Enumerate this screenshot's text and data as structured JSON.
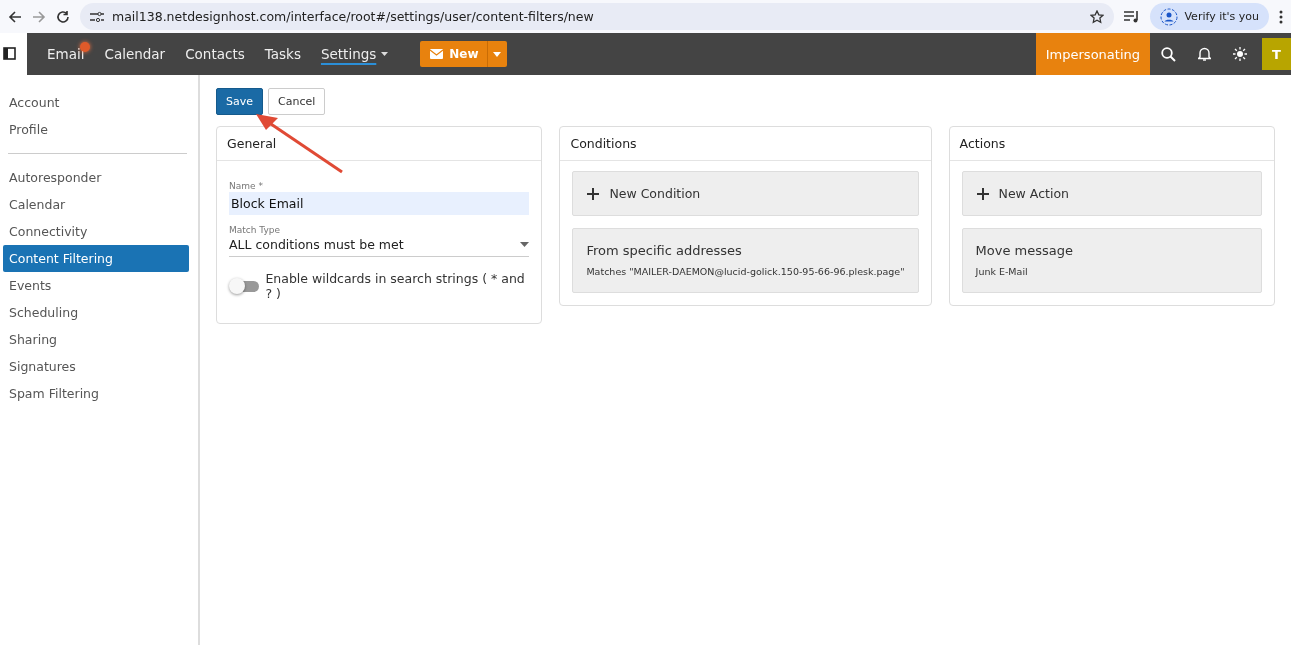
{
  "browser": {
    "url": "mail138.netdesignhost.com/interface/root#/settings/user/content-filters/new",
    "profile_button": "Verify it's you"
  },
  "nav": {
    "tabs": [
      {
        "label": "Email",
        "selected": false,
        "notification": true
      },
      {
        "label": "Calendar",
        "selected": false,
        "notification": false
      },
      {
        "label": "Contacts",
        "selected": false,
        "notification": false
      },
      {
        "label": "Tasks",
        "selected": false,
        "notification": false
      },
      {
        "label": "Settings",
        "selected": true,
        "notification": false
      }
    ],
    "new_button": "New",
    "impersonating": "Impersonating",
    "avatar": "T"
  },
  "sidebar": {
    "groups": [
      [
        {
          "label": "Account",
          "selected": false
        },
        {
          "label": "Profile",
          "selected": false
        }
      ],
      [
        {
          "label": "Autoresponder",
          "selected": false
        },
        {
          "label": "Calendar",
          "selected": false
        },
        {
          "label": "Connectivity",
          "selected": false
        },
        {
          "label": "Content Filtering",
          "selected": true
        },
        {
          "label": "Events",
          "selected": false
        },
        {
          "label": "Scheduling",
          "selected": false
        },
        {
          "label": "Sharing",
          "selected": false
        },
        {
          "label": "Signatures",
          "selected": false
        },
        {
          "label": "Spam Filtering",
          "selected": false
        }
      ]
    ]
  },
  "toolbar": {
    "save": "Save",
    "cancel": "Cancel"
  },
  "general": {
    "title": "General",
    "name_label": "Name *",
    "name_value": "Block Email",
    "match_label": "Match Type",
    "match_value": "ALL conditions must be met",
    "wildcards": {
      "label": "Enable wildcards in search strings ( * and ? )",
      "on": false
    }
  },
  "conditions": {
    "title": "Conditions",
    "add": "New Condition",
    "items": [
      {
        "title": "From specific addresses",
        "detail": "Matches \"MAILER-DAEMON@lucid-golick.150-95-66-96.plesk.page\""
      }
    ]
  },
  "actions": {
    "title": "Actions",
    "add": "New Action",
    "items": [
      {
        "title": "Move message",
        "detail": "Junk E-Mail"
      }
    ]
  }
}
